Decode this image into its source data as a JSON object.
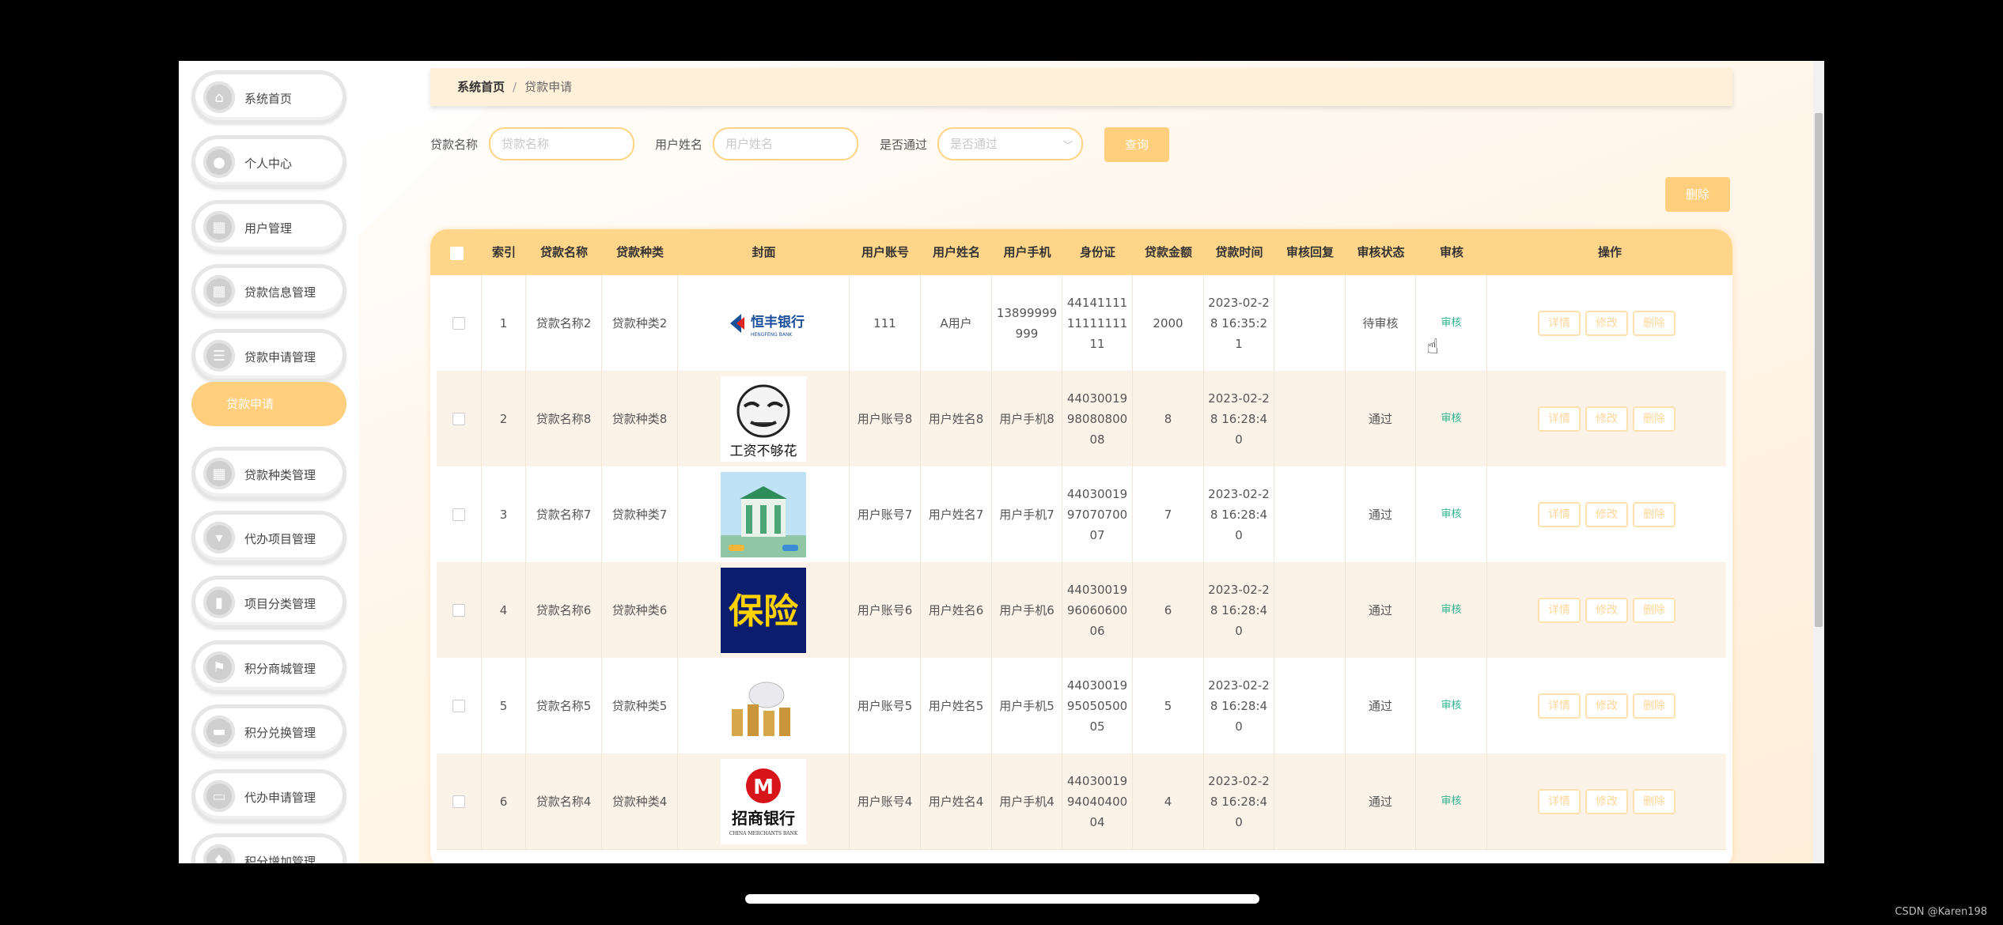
{
  "sidebar": {
    "items": [
      {
        "label": "系统首页",
        "icon": "home-icon"
      },
      {
        "label": "个人中心",
        "icon": "user-icon"
      },
      {
        "label": "用户管理",
        "icon": "grid-icon"
      },
      {
        "label": "贷款信息管理",
        "icon": "grid-icon"
      },
      {
        "label": "贷款申请管理",
        "icon": "list-icon"
      },
      {
        "label": "贷款种类管理",
        "icon": "grid-icon"
      },
      {
        "label": "代办项目管理",
        "icon": "download-icon"
      },
      {
        "label": "项目分类管理",
        "icon": "bar-chart-icon"
      },
      {
        "label": "积分商城管理",
        "icon": "flag-icon"
      },
      {
        "label": "积分兑换管理",
        "icon": "monitor-icon"
      },
      {
        "label": "代办申请管理",
        "icon": "ticket-icon"
      },
      {
        "label": "积分增加管理",
        "icon": "thumb-icon"
      }
    ],
    "sub_item": "贷款申请"
  },
  "breadcrumb": {
    "home": "系统首页",
    "separator": "/",
    "current": "贷款申请"
  },
  "filters": {
    "loan_name_label": "贷款名称",
    "loan_name_placeholder": "贷款名称",
    "user_name_label": "用户姓名",
    "user_name_placeholder": "用户姓名",
    "passed_label": "是否通过",
    "passed_placeholder": "是否通过",
    "search_button": "查询"
  },
  "delete_button": "删除",
  "table": {
    "headers": [
      "索引",
      "贷款名称",
      "贷款种类",
      "封面",
      "用户账号",
      "用户姓名",
      "用户手机",
      "身份证",
      "贷款金额",
      "贷款时间",
      "审核回复",
      "审核状态",
      "审核",
      "操作"
    ],
    "audit_label": "审核",
    "actions": {
      "detail": "详情",
      "edit": "修改",
      "delete": "删除"
    },
    "rows": [
      {
        "index": "1",
        "loan_name": "贷款名称2",
        "loan_type": "贷款种类2",
        "cover": "恒丰银行",
        "account": "111",
        "user_name": "A用户",
        "phone": "13899999999",
        "id_card": "441411111111111111",
        "amount": "2000",
        "time": "2023-02-28 16:35:21",
        "reply": "",
        "status": "待审核"
      },
      {
        "index": "2",
        "loan_name": "贷款名称8",
        "loan_type": "贷款种类8",
        "cover": "工资不够花",
        "account": "用户账号8",
        "user_name": "用户姓名8",
        "phone": "用户手机8",
        "id_card": "440300199808080008",
        "amount": "8",
        "time": "2023-02-28 16:28:40",
        "reply": "",
        "status": "通过"
      },
      {
        "index": "3",
        "loan_name": "贷款名称7",
        "loan_type": "贷款种类7",
        "cover": "bank-building",
        "account": "用户账号7",
        "user_name": "用户姓名7",
        "phone": "用户手机7",
        "id_card": "440300199707070007",
        "amount": "7",
        "time": "2023-02-28 16:28:40",
        "reply": "",
        "status": "通过"
      },
      {
        "index": "4",
        "loan_name": "贷款名称6",
        "loan_type": "贷款种类6",
        "cover": "保险",
        "account": "用户账号6",
        "user_name": "用户姓名6",
        "phone": "用户手机6",
        "id_card": "440300199606060006",
        "amount": "6",
        "time": "2023-02-28 16:28:40",
        "reply": "",
        "status": "通过"
      },
      {
        "index": "5",
        "loan_name": "贷款名称5",
        "loan_type": "贷款种类5",
        "cover": "piggy-bank-coins",
        "account": "用户账号5",
        "user_name": "用户姓名5",
        "phone": "用户手机5",
        "id_card": "440300199505050005",
        "amount": "5",
        "time": "2023-02-28 16:28:40",
        "reply": "",
        "status": "通过"
      },
      {
        "index": "6",
        "loan_name": "贷款名称4",
        "loan_type": "贷款种类4",
        "cover": "招商银行",
        "account": "用户账号4",
        "user_name": "用户姓名4",
        "phone": "用户手机4",
        "id_card": "440300199404040004",
        "amount": "4",
        "time": "2023-02-28 16:28:40",
        "reply": "",
        "status": "通过"
      }
    ]
  },
  "cover_sub": {
    "cmb": "CHINA MERCHANTS BANK",
    "hengfeng": "HENGFENG BANK"
  },
  "watermark": "CSDN @Karen198",
  "colors": {
    "accent": "#ffcf7d",
    "header": "#ffd689",
    "audit": "#2fb38f"
  }
}
